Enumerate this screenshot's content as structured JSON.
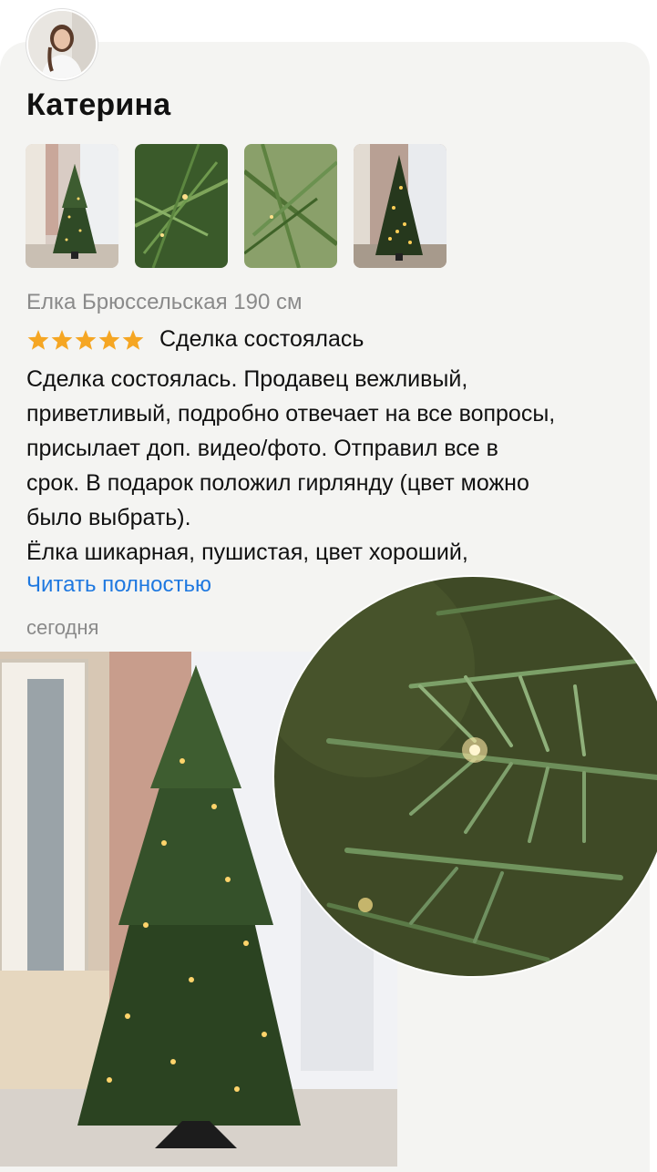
{
  "review": {
    "author_name": "Катерина",
    "product_name": "Елка Брюссельская 190 см",
    "rating": 5,
    "rating_max": 5,
    "deal_status": "Сделка состоялась",
    "text_lines": [
      "Сделка состоялась. Продавец вежливый,",
      "приветливый, подробно отвечает на все вопросы,",
      "присылает доп. видео/фото. Отправил все в",
      "срок. В подарок положил гирлянду (цвет можно",
      "было выбрать).",
      "Ёлка шикарная, пушистая, цвет хороший,"
    ],
    "read_more_label": "Читать полностью",
    "date": "сегодня"
  },
  "colors": {
    "star": "#f5a623",
    "link": "#1e78e0",
    "muted": "#8a8a8a",
    "card_bg": "#f4f4f2"
  },
  "icons": {
    "rating": "star-icon"
  }
}
